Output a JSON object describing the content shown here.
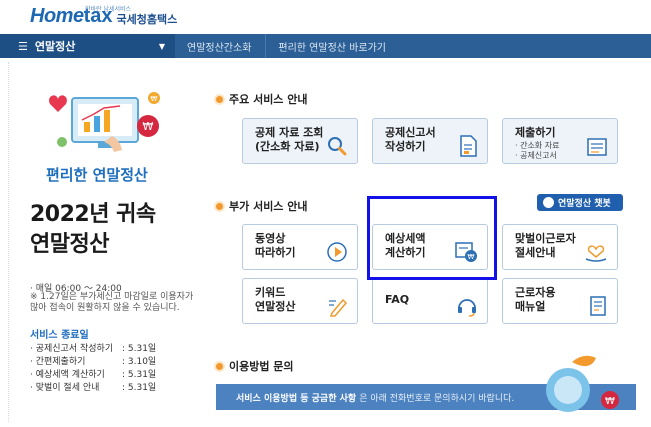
{
  "logo": {
    "brand_home": "Home",
    "brand_tax": "tax",
    "brand_sub": "국세청홈택스",
    "brand_tiny": "한바란 납세서비스"
  },
  "navbar": {
    "menu_label": "연말정산",
    "links": [
      "연말정산간소화",
      "편리한 연말정산 바로가기"
    ]
  },
  "left": {
    "subtitle": "편리한 연말정산",
    "title_line1": "2022년 귀속",
    "title_line2": "연말정산",
    "hours": "· 매일 06:00 ～ 24:00",
    "notice": "※ 1.27일은 부가세신고 마감일로 이용자가 많아 접속이 원활하지 않을 수 있습니다.",
    "schedule_title": "서비스 종료일",
    "schedule": [
      {
        "label": "· 공제신고서 작성하기",
        "date": ": 5.31일"
      },
      {
        "label": "· 간편제출하기",
        "date": ": 3.10일"
      },
      {
        "label": "· 예상세액 계산하기",
        "date": ": 5.31일"
      },
      {
        "label": "· 맞벌이 절세 안내",
        "date": ": 5.31일"
      }
    ]
  },
  "sections": {
    "main_title": "주요 서비스 안내",
    "extra_title": "부가 서비스 안내",
    "contact_title": "이용방법 문의"
  },
  "main_services": [
    {
      "label": "공제 자료 조회\n(간소화 자료)",
      "icon": "magnifier-icon"
    },
    {
      "label": "공제신고서\n작성하기",
      "icon": "document-icon"
    },
    {
      "label": "제출하기",
      "icon": "report-icon",
      "bullets": [
        "· 간소화 자료",
        "· 공제신고서"
      ]
    }
  ],
  "extra_services": [
    {
      "label": "동영상\n따라하기",
      "icon": "play-icon"
    },
    {
      "label": "예상세액\n계산하기",
      "icon": "tax-calc-icon"
    },
    {
      "label": "맞벌이근로자\n절세안내",
      "icon": "couple-icon"
    },
    {
      "label": "키워드\n연말정산",
      "icon": "pencil-icon"
    },
    {
      "label": "FAQ",
      "icon": "headset-icon"
    },
    {
      "label": "근로자용\n매뉴얼",
      "icon": "manual-icon"
    }
  ],
  "chatbot_label": "연말정산 챗봇",
  "banner": {
    "bold": "서비스 이용방법 등 궁금한 사항",
    "rest": "은 아래 전화번호로 문의하시기 바랍니다."
  },
  "colors": {
    "accent": "#1f5fae",
    "nav": "#2b5f95",
    "highlight": "#1212e8"
  }
}
